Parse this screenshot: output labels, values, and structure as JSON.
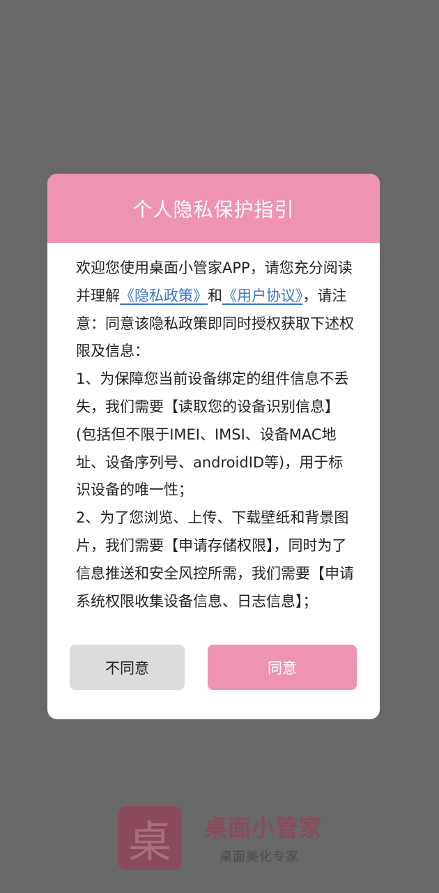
{
  "dialog": {
    "title": "个人隐私保护指引",
    "intro_a": "欢迎您使用桌面小管家APP，请您充分阅读并理解",
    "privacy_link": "《隐私政策》",
    "intro_and": "和",
    "terms_link": "《用户协议》",
    "intro_b": "，请注意：同意该隐私政策即同时授权获取下述权限及信息：",
    "item1": "1、为保障您当前设备绑定的组件信息不丢失，我们需要【读取您的设备识别信息】(包括但不限于IMEI、IMSI、设备MAC地址、设备序列号、androidID等)，用于标识设备的唯一性；",
    "item2": "2、为了您浏览、上传、下载壁纸和背景图片，我们需要【申请存储权限】，同时为了信息推送和安全风控所需，我们需要【申请系统权限收集设备信息、日志信息】；",
    "disagree_label": "不同意",
    "agree_label": "同意"
  },
  "splash": {
    "logo_char": "桌",
    "app_name": "桌面小管家",
    "slogan": "桌面美化专家"
  },
  "colors": {
    "overlay": "#686868",
    "accent_pink": "#ee93b4",
    "link_blue": "#3b73c9",
    "disagree_bg": "#dcdcdc",
    "brand": "#8a4a5c"
  }
}
